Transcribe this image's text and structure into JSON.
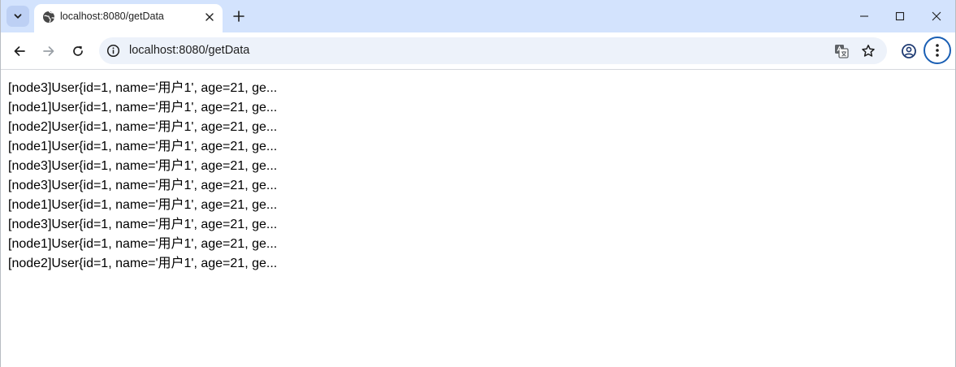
{
  "tab": {
    "title": "localhost:8080/getData",
    "favicon": "globe-icon"
  },
  "address_bar": {
    "url": "localhost:8080/getData"
  },
  "colors": {
    "tabstrip": "#d3e3fd",
    "omnibox": "#edf2fa",
    "menu_ring": "#1a5fb4"
  },
  "content": {
    "lines": [
      "[node3]User{id=1, name='用户1', age=21, ge...",
      "[node1]User{id=1, name='用户1', age=21, ge...",
      "[node2]User{id=1, name='用户1', age=21, ge...",
      "[node1]User{id=1, name='用户1', age=21, ge...",
      "[node3]User{id=1, name='用户1', age=21, ge...",
      "[node3]User{id=1, name='用户1', age=21, ge...",
      "[node1]User{id=1, name='用户1', age=21, ge...",
      "[node3]User{id=1, name='用户1', age=21, ge...",
      "[node1]User{id=1, name='用户1', age=21, ge...",
      "[node2]User{id=1, name='用户1', age=21, ge..."
    ]
  }
}
